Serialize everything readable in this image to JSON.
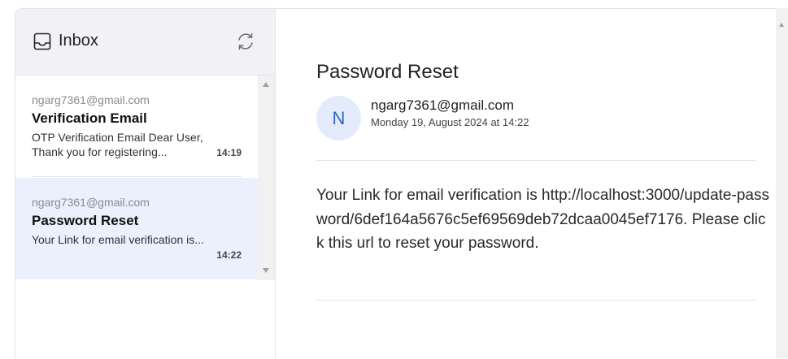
{
  "sidebar": {
    "title": "Inbox",
    "inbox_icon": "inbox-tray-icon",
    "refresh_icon": "refresh-icon",
    "items": [
      {
        "from": "ngarg7361@gmail.com",
        "subject": "Verification Email",
        "preview": "OTP Verification Email Dear User, Thank you for registering...",
        "time": "14:19",
        "selected": false
      },
      {
        "from": "ngarg7361@gmail.com",
        "subject": "Password Reset",
        "preview": "Your Link for email verification is...",
        "time": "14:22",
        "selected": true
      }
    ]
  },
  "reader": {
    "subject": "Password Reset",
    "avatar_initial": "N",
    "from": "ngarg7361@gmail.com",
    "date": "Monday 19, August 2024 at 14:22",
    "body": "Your Link for email verification is http://localhost:3000/update-password/6def164a5676c5ef69569deb72dcaa0045ef7176. Please click this url to reset your password."
  },
  "colors": {
    "selected_bg": "#eaf0fc",
    "header_bg": "#f2f2f6",
    "avatar_bg": "#e4ecfb",
    "avatar_text": "#2f66c8"
  }
}
